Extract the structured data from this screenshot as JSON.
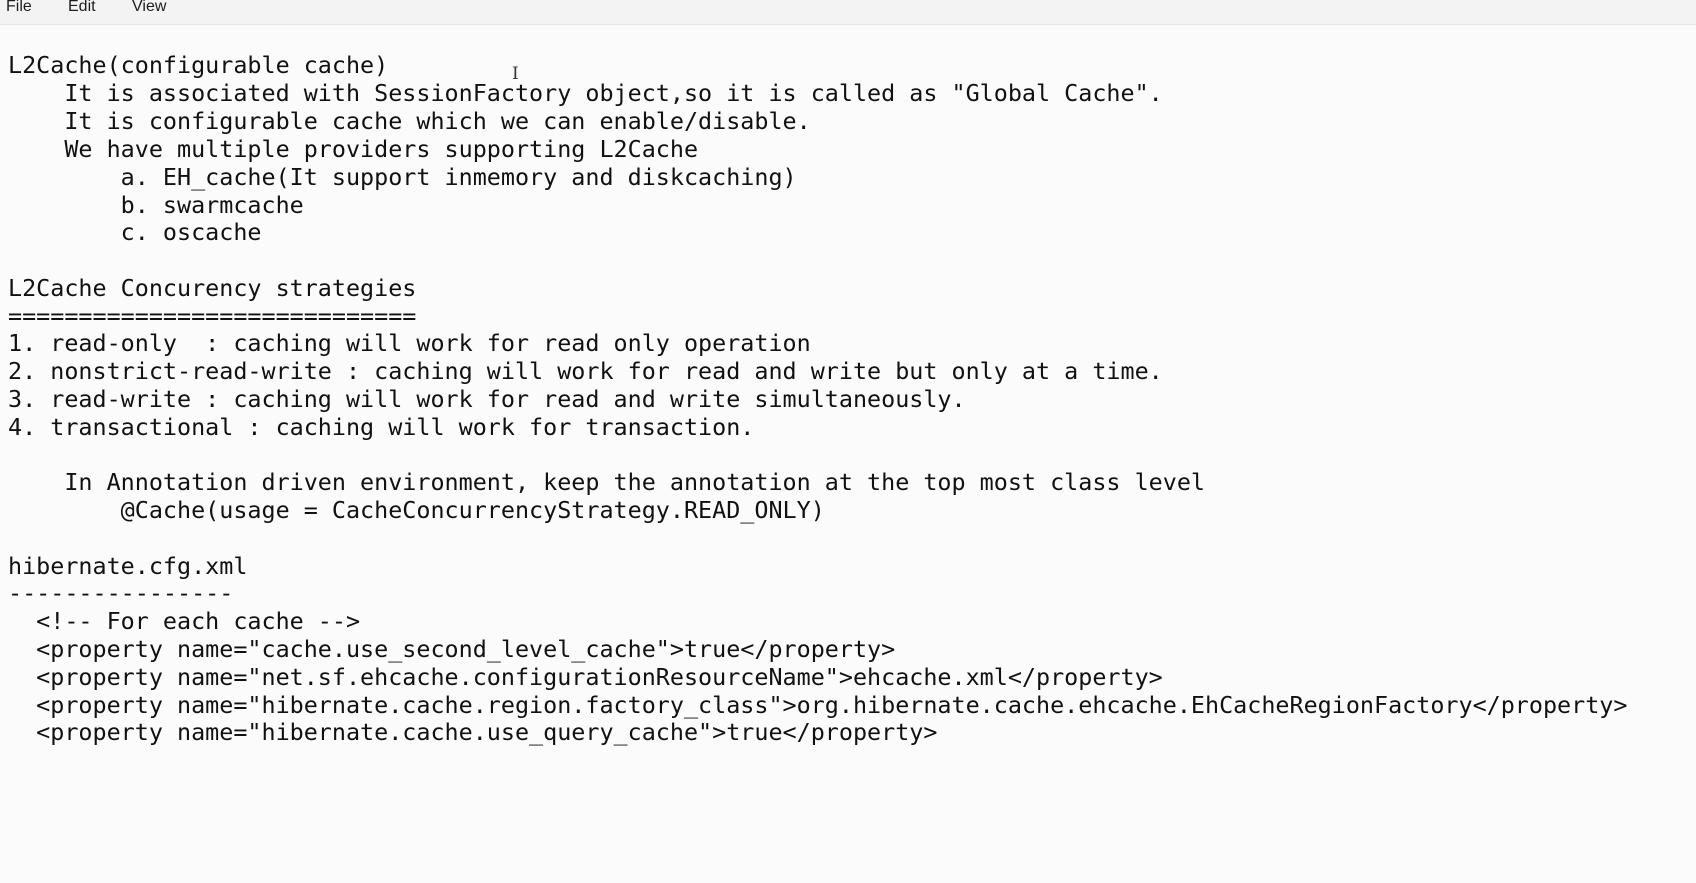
{
  "menu": {
    "items": [
      "File",
      "Edit",
      "View"
    ]
  },
  "editor": {
    "lines": [
      "",
      "L2Cache(configurable cache)",
      "    It is associated with SessionFactory object,so it is called as \"Global Cache\".",
      "    It is configurable cache which we can enable/disable.",
      "    We have multiple providers supporting L2Cache",
      "        a. EH_cache(It support inmemory and diskcaching)",
      "        b. swarmcache",
      "        c. oscache",
      "",
      "L2Cache Concurency strategies",
      "=============================",
      "1. read-only  : caching will work for read only operation",
      "2. nonstrict-read-write : caching will work for read and write but only at a time.",
      "3. read-write : caching will work for read and write simultaneously.",
      "4. transactional : caching will work for transaction.",
      "",
      "    In Annotation driven environment, keep the annotation at the top most class level",
      "        @Cache(usage = CacheConcurrencyStrategy.READ_ONLY)",
      "",
      "hibernate.cfg.xml",
      "----------------",
      "  <!-- For each cache -->",
      "  <property name=\"cache.use_second_level_cache\">true</property>",
      "  <property name=\"net.sf.ehcache.configurationResourceName\">ehcache.xml</property>",
      "  <property name=\"hibernate.cache.region.factory_class\">org.hibernate.cache.ehcache.EhCacheRegionFactory</property>",
      "  <property name=\"hibernate.cache.use_query_cache\">true</property>"
    ]
  },
  "cursor_glyph": "I"
}
